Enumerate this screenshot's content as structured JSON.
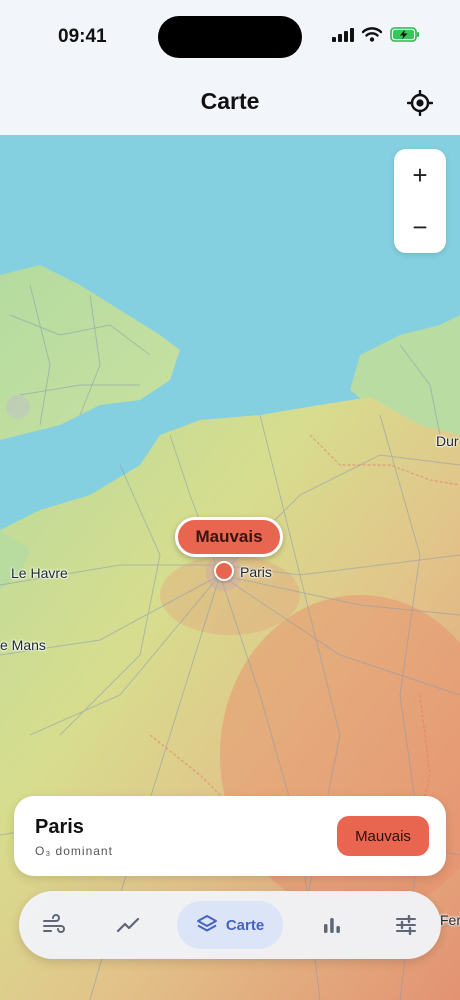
{
  "status_bar": {
    "time": "09:41"
  },
  "header": {
    "title": "Carte"
  },
  "map": {
    "zoom_in_label": "+",
    "zoom_out_label": "−",
    "city_labels": {
      "paris": "Paris",
      "le_havre": "Le Havre",
      "le_mans": "e Mans",
      "dunkerque": "Dur",
      "right_bottom": "Fer"
    },
    "marker": {
      "label": "Mauvais",
      "color": "#e8654f"
    }
  },
  "card": {
    "city": "Paris",
    "pollutant": "O₃ dominant",
    "badge": "Mauvais"
  },
  "tabbar": {
    "active": {
      "label": "Carte"
    },
    "icons": [
      "wind-icon",
      "trend-icon",
      "layers-icon",
      "bar-chart-icon",
      "sliders-icon"
    ]
  },
  "colors": {
    "accent": "#4663c4",
    "bad": "#e8654f",
    "sea": "#7ecde0"
  }
}
